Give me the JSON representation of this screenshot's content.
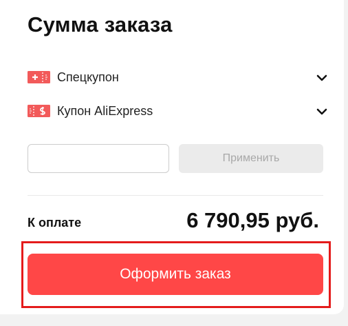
{
  "order_summary": {
    "title": "Сумма заказа",
    "coupons": [
      {
        "label": "Спецкупон",
        "icon": "special-coupon-icon"
      },
      {
        "label": "Купон AliExpress",
        "icon": "aliexpress-coupon-icon"
      }
    ],
    "code_input": {
      "value": "",
      "placeholder": ""
    },
    "apply_label": "Применить",
    "total_label": "К оплате",
    "total_value": "6 790,95 руб.",
    "order_button_label": "Оформить заказ"
  },
  "colors": {
    "accent": "#ff4747",
    "highlight_border": "#e41b1b",
    "coupon_icon": "#f25a5a",
    "apply_disabled_bg": "#ebebeb"
  }
}
